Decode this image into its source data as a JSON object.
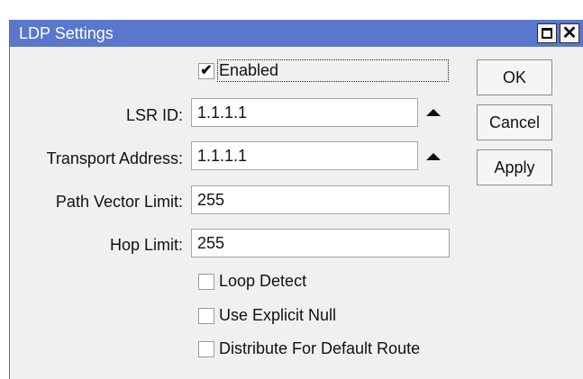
{
  "window": {
    "title": "LDP Settings",
    "close_glyph": "✕"
  },
  "enabled": {
    "label": "Enabled",
    "checked": true,
    "check_glyph": "✔"
  },
  "fields": {
    "lsr_id": {
      "label": "LSR ID:",
      "value": "1.1.1.1"
    },
    "transport_address": {
      "label": "Transport Address:",
      "value": "1.1.1.1"
    },
    "path_vector_limit": {
      "label": "Path Vector Limit:",
      "value": "255"
    },
    "hop_limit": {
      "label": "Hop Limit:",
      "value": "255"
    }
  },
  "options": {
    "loop_detect": {
      "label": "Loop Detect",
      "checked": false
    },
    "use_explicit_null": {
      "label": "Use Explicit Null",
      "checked": false
    },
    "distribute_default_route": {
      "label": "Distribute For Default Route",
      "checked": false
    }
  },
  "buttons": {
    "ok": "OK",
    "cancel": "Cancel",
    "apply": "Apply"
  },
  "icons": {
    "collapse": "triangle-up-icon"
  },
  "colors": {
    "titlebar": "#5a77cd",
    "background": "#f0f0f0"
  }
}
